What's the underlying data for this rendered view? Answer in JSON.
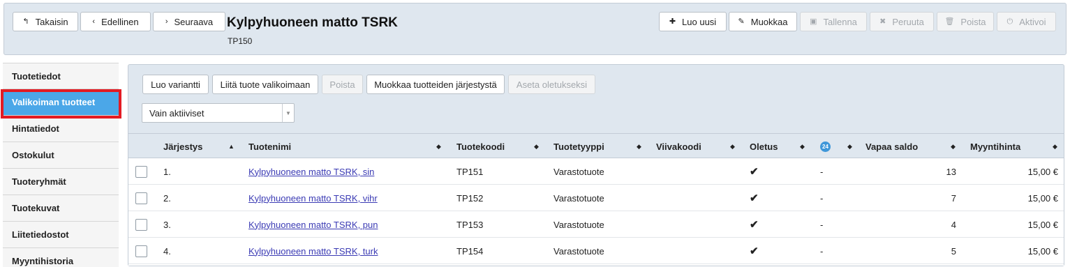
{
  "toolbar": {
    "back_label": "Takaisin",
    "previous_label": "Edellinen",
    "next_label": "Seuraava",
    "new_label": "Luo uusi",
    "edit_label": "Muokkaa",
    "save_label": "Tallenna",
    "cancel_label": "Peruuta",
    "delete_label": "Poista",
    "activate_label": "Aktivoi"
  },
  "header": {
    "title": "Kylpyhuoneen matto TSRK",
    "code": "TP150"
  },
  "sidebar": {
    "items": [
      {
        "label": "Tuotetiedot"
      },
      {
        "label": "Valikoiman tuotteet",
        "active": true
      },
      {
        "label": "Hintatiedot"
      },
      {
        "label": "Ostokulut"
      },
      {
        "label": "Tuoteryhmät"
      },
      {
        "label": "Tuotekuvat"
      },
      {
        "label": "Liitetiedostot"
      },
      {
        "label": "Myyntihistoria"
      }
    ]
  },
  "actions": {
    "create_variant": "Luo variantti",
    "attach_product": "Liitä tuote valikoimaan",
    "remove": "Poista",
    "edit_order": "Muokkaa tuotteiden järjestystä",
    "set_default": "Aseta oletukseksi"
  },
  "filter": {
    "value": "Vain aktiiviset"
  },
  "table": {
    "columns": {
      "order": "Järjestys",
      "name": "Tuotenimi",
      "code": "Tuotekoodi",
      "type": "Tuotetyyppi",
      "barcode": "Viivakoodi",
      "default": "Oletus",
      "badge": "24",
      "free_balance": "Vapaa saldo",
      "price": "Myyntihinta"
    },
    "rows": [
      {
        "order": "1.",
        "name": "Kylpyhuoneen matto TSRK, sin",
        "code": "TP151",
        "type": "Varastotuote",
        "barcode": "",
        "default": "✔",
        "badge": "-",
        "free_balance": "13",
        "price": "15,00 €"
      },
      {
        "order": "2.",
        "name": "Kylpyhuoneen matto TSRK, vihr",
        "code": "TP152",
        "type": "Varastotuote",
        "barcode": "",
        "default": "✔",
        "badge": "-",
        "free_balance": "7",
        "price": "15,00 €"
      },
      {
        "order": "3.",
        "name": "Kylpyhuoneen matto TSRK, pun",
        "code": "TP153",
        "type": "Varastotuote",
        "barcode": "",
        "default": "✔",
        "badge": "-",
        "free_balance": "4",
        "price": "15,00 €"
      },
      {
        "order": "4.",
        "name": "Kylpyhuoneen matto TSRK, turk",
        "code": "TP154",
        "type": "Varastotuote",
        "barcode": "",
        "default": "✔",
        "badge": "-",
        "free_balance": "5",
        "price": "15,00 €"
      }
    ]
  },
  "colors": {
    "header_bg": "#dfe7ef",
    "active_tab": "#4ba7e8",
    "highlight": "#e31b23",
    "link": "#3b3bb4",
    "badge": "#3f97d9"
  }
}
